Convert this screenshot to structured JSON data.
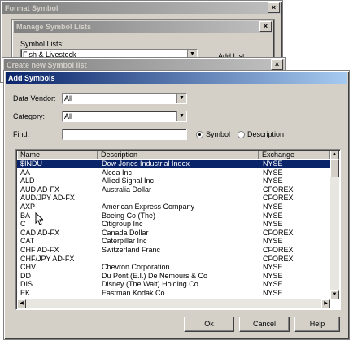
{
  "format_symbol": {
    "title": "Format Symbol"
  },
  "manage_lists": {
    "title": "Manage Symbol Lists",
    "symbol_lists_label": "Symbol Lists:",
    "selected_list": "Fish & Livestock",
    "add_list_button": "Add List"
  },
  "create_list": {
    "title": "Create new Symbol list"
  },
  "add_symbols": {
    "title": "Add Symbols",
    "data_vendor_label": "Data Vendor:",
    "data_vendor_value": "All",
    "category_label": "Category:",
    "category_value": "All",
    "find_label": "Find:",
    "find_value": "",
    "radio_symbol": "Symbol",
    "radio_description": "Description",
    "columns": [
      "Name",
      "Description",
      "Exchange"
    ],
    "rows": [
      [
        "$INDU",
        "Dow Jones Industrial Index",
        "NYSE"
      ],
      [
        "AA",
        "Alcoa Inc",
        "NYSE"
      ],
      [
        "ALD",
        "Allied Signal Inc",
        "NYSE"
      ],
      [
        "AUD AD-FX",
        "Australia Dollar",
        "CFOREX"
      ],
      [
        "AUD/JPY AD-FX",
        "",
        "CFOREX"
      ],
      [
        "AXP",
        "American Express Company",
        "NYSE"
      ],
      [
        "BA",
        "Boeing Co (The)",
        "NYSE"
      ],
      [
        "C",
        "Citigroup Inc",
        "NYSE"
      ],
      [
        "CAD AD-FX",
        "Canada Dollar",
        "CFOREX"
      ],
      [
        "CAT",
        "Caterpillar Inc",
        "NYSE"
      ],
      [
        "CHF AD-FX",
        "Switzerland Franc",
        "CFOREX"
      ],
      [
        "CHF/JPY AD-FX",
        "",
        "CFOREX"
      ],
      [
        "CHV",
        "Chevron Corporation",
        "NYSE"
      ],
      [
        "DD",
        "Du Pont (E.I.) De Nemours & Co",
        "NYSE"
      ],
      [
        "DIS",
        "Disney (The Walt) Holding Co",
        "NYSE"
      ],
      [
        "EK",
        "Eastman Kodak Co",
        "NYSE"
      ]
    ],
    "ok_button": "Ok",
    "cancel_button": "Cancel",
    "help_button": "Help"
  }
}
